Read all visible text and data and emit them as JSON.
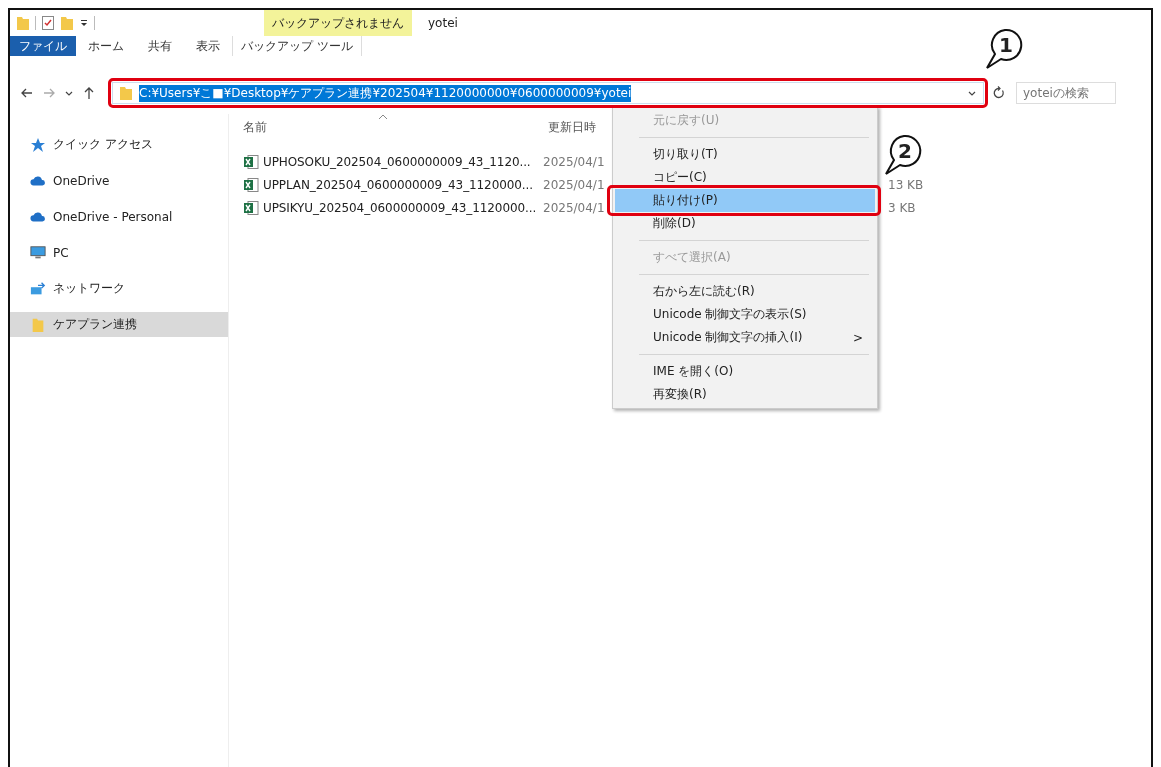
{
  "title_bar": {
    "context_tab": "バックアップされません",
    "title": "yotei"
  },
  "ribbon_tabs": [
    {
      "label": "ファイル",
      "kind": "file"
    },
    {
      "label": "ホーム",
      "kind": "normal"
    },
    {
      "label": "共有",
      "kind": "normal"
    },
    {
      "label": "表示",
      "kind": "normal"
    },
    {
      "label": "バックアップ ツール",
      "kind": "context"
    }
  ],
  "address_bar": {
    "path": "C:¥Users¥こ■¥Desktop¥ケアプラン連携¥202504¥1120000000¥0600000009¥yotei",
    "text_selected": true
  },
  "search": {
    "placeholder": "yoteiの検索"
  },
  "nav_pane": [
    {
      "label": "クイック アクセス",
      "kind": "star",
      "selected": false
    },
    {
      "label": "OneDrive",
      "kind": "cloud",
      "selected": false
    },
    {
      "label": "OneDrive - Personal",
      "kind": "cloud",
      "selected": false
    },
    {
      "label": "PC",
      "kind": "pc",
      "selected": false
    },
    {
      "label": "ネットワーク",
      "kind": "network",
      "selected": false
    },
    {
      "label": "ケアプラン連携",
      "kind": "folder",
      "selected": true
    }
  ],
  "columns": [
    "名前",
    "更新日時"
  ],
  "files": [
    {
      "name": "UPHOSOKU_202504_0600000009_43_1120...",
      "date": "2025/04/1"
    },
    {
      "name": "UPPLAN_202504_0600000009_43_1120000...",
      "date": "2025/04/1",
      "size": "13 KB"
    },
    {
      "name": "UPSIKYU_202504_0600000009_43_1120000...",
      "date": "2025/04/1",
      "size": "3 KB"
    }
  ],
  "context_menu": [
    {
      "kind": "item",
      "label": "元に戻す(U)",
      "disabled": true,
      "selected": false
    },
    {
      "kind": "separator"
    },
    {
      "kind": "item",
      "label": "切り取り(T)",
      "disabled": false,
      "selected": false
    },
    {
      "kind": "item",
      "label": "コピー(C)",
      "disabled": false,
      "selected": false
    },
    {
      "kind": "item",
      "label": "貼り付け(P)",
      "disabled": false,
      "selected": true
    },
    {
      "kind": "item",
      "label": "削除(D)",
      "disabled": false,
      "selected": false
    },
    {
      "kind": "separator"
    },
    {
      "kind": "item",
      "label": "すべて選択(A)",
      "disabled": true,
      "selected": false
    },
    {
      "kind": "separator"
    },
    {
      "kind": "item",
      "label": "右から左に読む(R)",
      "disabled": false,
      "selected": false
    },
    {
      "kind": "item",
      "label": "Unicode 制御文字の表示(S)",
      "disabled": false,
      "selected": false
    },
    {
      "kind": "submenu",
      "label": "Unicode 制御文字の挿入(I)",
      "arrow": ">",
      "disabled": false,
      "selected": false
    },
    {
      "kind": "separator"
    },
    {
      "kind": "item",
      "label": "IME を開く(O)",
      "disabled": false,
      "selected": false
    },
    {
      "kind": "item",
      "label": "再変換(R)",
      "disabled": false,
      "selected": false
    }
  ],
  "annotations": [
    {
      "number": "1"
    },
    {
      "number": "2"
    }
  ]
}
